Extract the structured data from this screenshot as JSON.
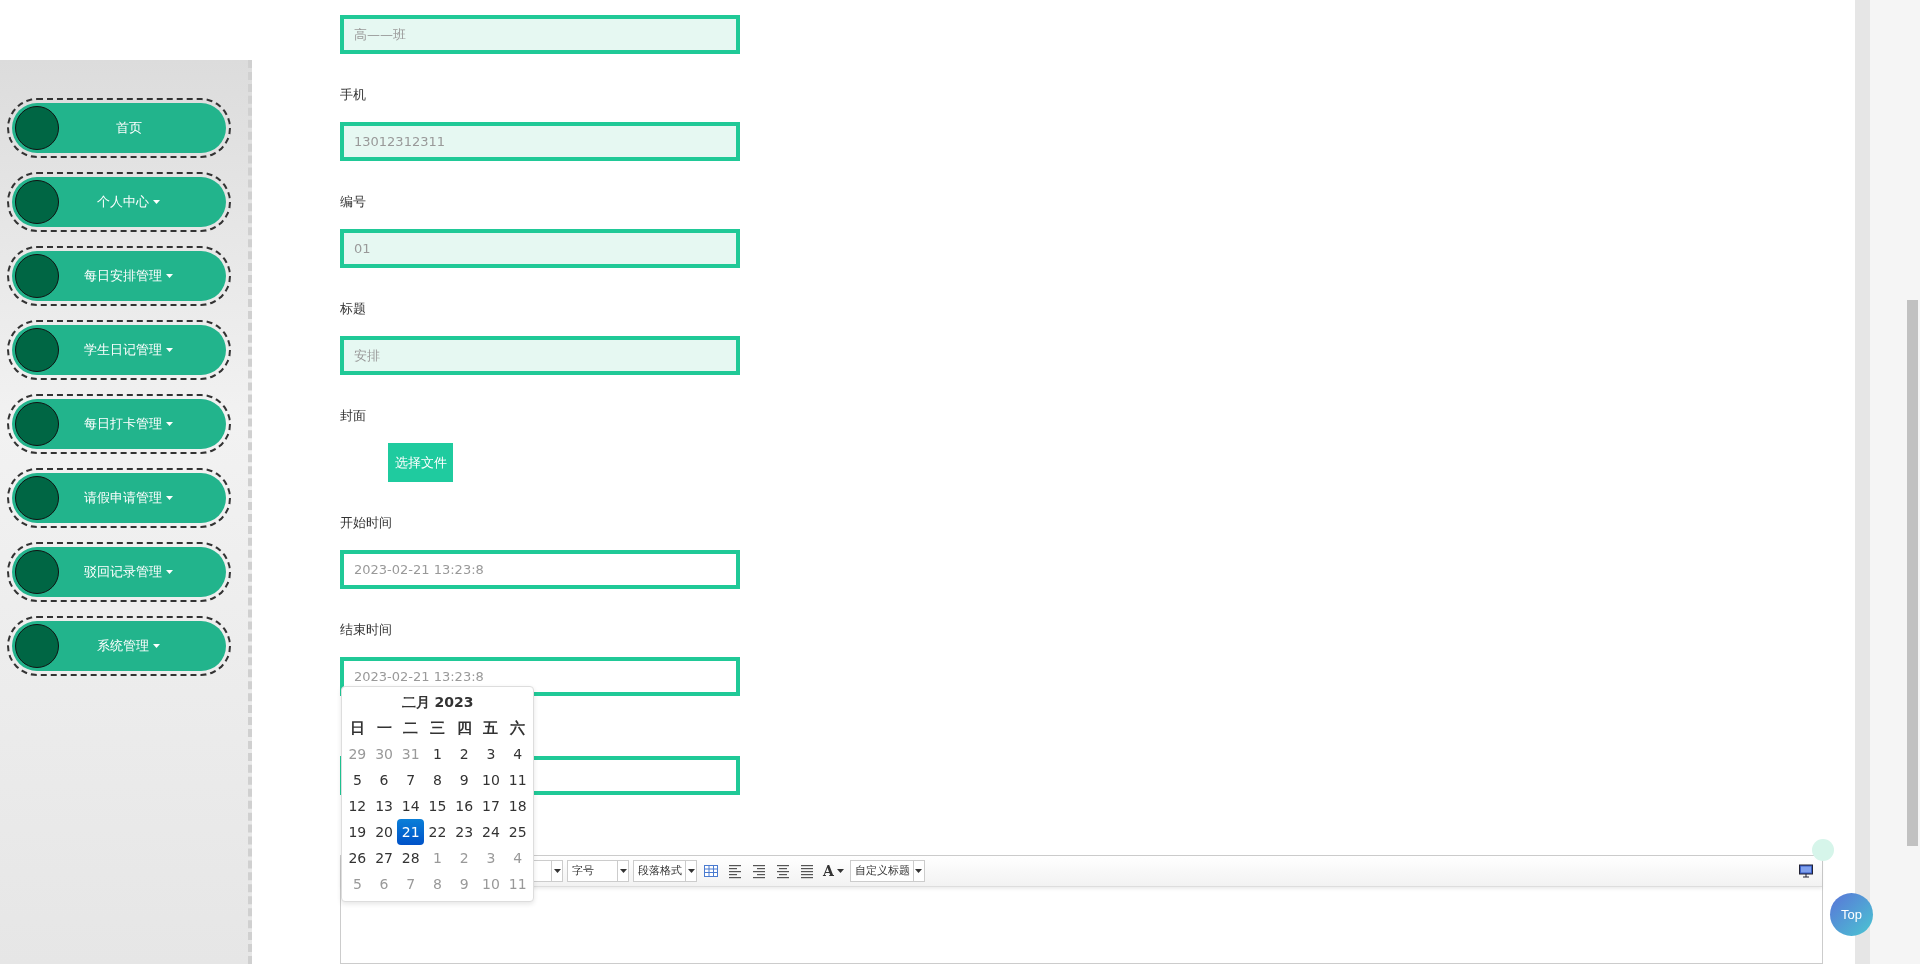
{
  "sidebar": {
    "items": [
      {
        "label": "首页",
        "has_menu": false
      },
      {
        "label": "个人中心",
        "has_menu": true
      },
      {
        "label": "每日安排管理",
        "has_menu": true
      },
      {
        "label": "学生日记管理",
        "has_menu": true
      },
      {
        "label": "每日打卡管理",
        "has_menu": true
      },
      {
        "label": "请假申请管理",
        "has_menu": true
      },
      {
        "label": "驳回记录管理",
        "has_menu": true
      },
      {
        "label": "系统管理",
        "has_menu": true
      }
    ]
  },
  "form": {
    "items": [
      {
        "kind": "input",
        "value": "高——班",
        "readonly": true
      },
      {
        "kind": "input",
        "label": "手机",
        "value": "13012312311",
        "readonly": true
      },
      {
        "kind": "input",
        "label": "编号",
        "value": "01",
        "readonly": true
      },
      {
        "kind": "input",
        "label": "标题",
        "value": "安排",
        "readonly": true
      },
      {
        "kind": "file",
        "label": "封面",
        "button": "选择文件"
      },
      {
        "kind": "input",
        "label": "开始时间",
        "value": "2023-02-21 13:23:8",
        "readonly": false
      },
      {
        "kind": "input",
        "label": "结束时间",
        "value": "2023-02-21 13:23:8",
        "readonly": false
      },
      {
        "kind": "input",
        "readonly": false
      },
      {
        "kind": "editor",
        "toolbar": [
          {
            "kind": "select"
          },
          {
            "kind": "select",
            "label": "字号"
          },
          {
            "kind": "select",
            "label": "段落格式"
          },
          {
            "kind": "table"
          },
          {
            "kind": "align-left"
          },
          {
            "kind": "align-right"
          },
          {
            "kind": "align-center"
          },
          {
            "kind": "justify"
          },
          {
            "kind": "color",
            "label": "A"
          },
          {
            "kind": "select",
            "label": "自定义标题"
          },
          {
            "kind": "fullscreen"
          }
        ]
      }
    ]
  },
  "calendar": {
    "title": "二月 2023",
    "weekdays": [
      "日",
      "一",
      "二",
      "三",
      "四",
      "五",
      "六"
    ],
    "weeks": [
      [
        {
          "day": "29",
          "muted": true,
          "selected": false
        },
        {
          "day": "30",
          "muted": true,
          "selected": false
        },
        {
          "day": "31",
          "muted": true,
          "selected": false
        },
        {
          "day": "1",
          "muted": false,
          "selected": false
        },
        {
          "day": "2",
          "muted": false,
          "selected": false
        },
        {
          "day": "3",
          "muted": false,
          "selected": false
        },
        {
          "day": "4",
          "muted": false,
          "selected": false
        }
      ],
      [
        {
          "day": "5",
          "muted": false,
          "selected": false
        },
        {
          "day": "6",
          "muted": false,
          "selected": false
        },
        {
          "day": "7",
          "muted": false,
          "selected": false
        },
        {
          "day": "8",
          "muted": false,
          "selected": false
        },
        {
          "day": "9",
          "muted": false,
          "selected": false
        },
        {
          "day": "10",
          "muted": false,
          "selected": false
        },
        {
          "day": "11",
          "muted": false,
          "selected": false
        }
      ],
      [
        {
          "day": "12",
          "muted": false,
          "selected": false
        },
        {
          "day": "13",
          "muted": false,
          "selected": false
        },
        {
          "day": "14",
          "muted": false,
          "selected": false
        },
        {
          "day": "15",
          "muted": false,
          "selected": false
        },
        {
          "day": "16",
          "muted": false,
          "selected": false
        },
        {
          "day": "17",
          "muted": false,
          "selected": false
        },
        {
          "day": "18",
          "muted": false,
          "selected": false
        }
      ],
      [
        {
          "day": "19",
          "muted": false,
          "selected": false
        },
        {
          "day": "20",
          "muted": false,
          "selected": false
        },
        {
          "day": "21",
          "muted": false,
          "selected": true
        },
        {
          "day": "22",
          "muted": false,
          "selected": false
        },
        {
          "day": "23",
          "muted": false,
          "selected": false
        },
        {
          "day": "24",
          "muted": false,
          "selected": false
        },
        {
          "day": "25",
          "muted": false,
          "selected": false
        }
      ],
      [
        {
          "day": "26",
          "muted": false,
          "selected": false
        },
        {
          "day": "27",
          "muted": false,
          "selected": false
        },
        {
          "day": "28",
          "muted": false,
          "selected": false
        },
        {
          "day": "1",
          "muted": true,
          "selected": false
        },
        {
          "day": "2",
          "muted": true,
          "selected": false
        },
        {
          "day": "3",
          "muted": true,
          "selected": false
        },
        {
          "day": "4",
          "muted": true,
          "selected": false
        }
      ],
      [
        {
          "day": "5",
          "muted": true,
          "selected": false
        },
        {
          "day": "6",
          "muted": true,
          "selected": false
        },
        {
          "day": "7",
          "muted": true,
          "selected": false
        },
        {
          "day": "8",
          "muted": true,
          "selected": false
        },
        {
          "day": "9",
          "muted": true,
          "selected": false
        },
        {
          "day": "10",
          "muted": true,
          "selected": false
        },
        {
          "day": "11",
          "muted": true,
          "selected": false
        }
      ]
    ]
  },
  "top_button": {
    "label": "Top"
  }
}
